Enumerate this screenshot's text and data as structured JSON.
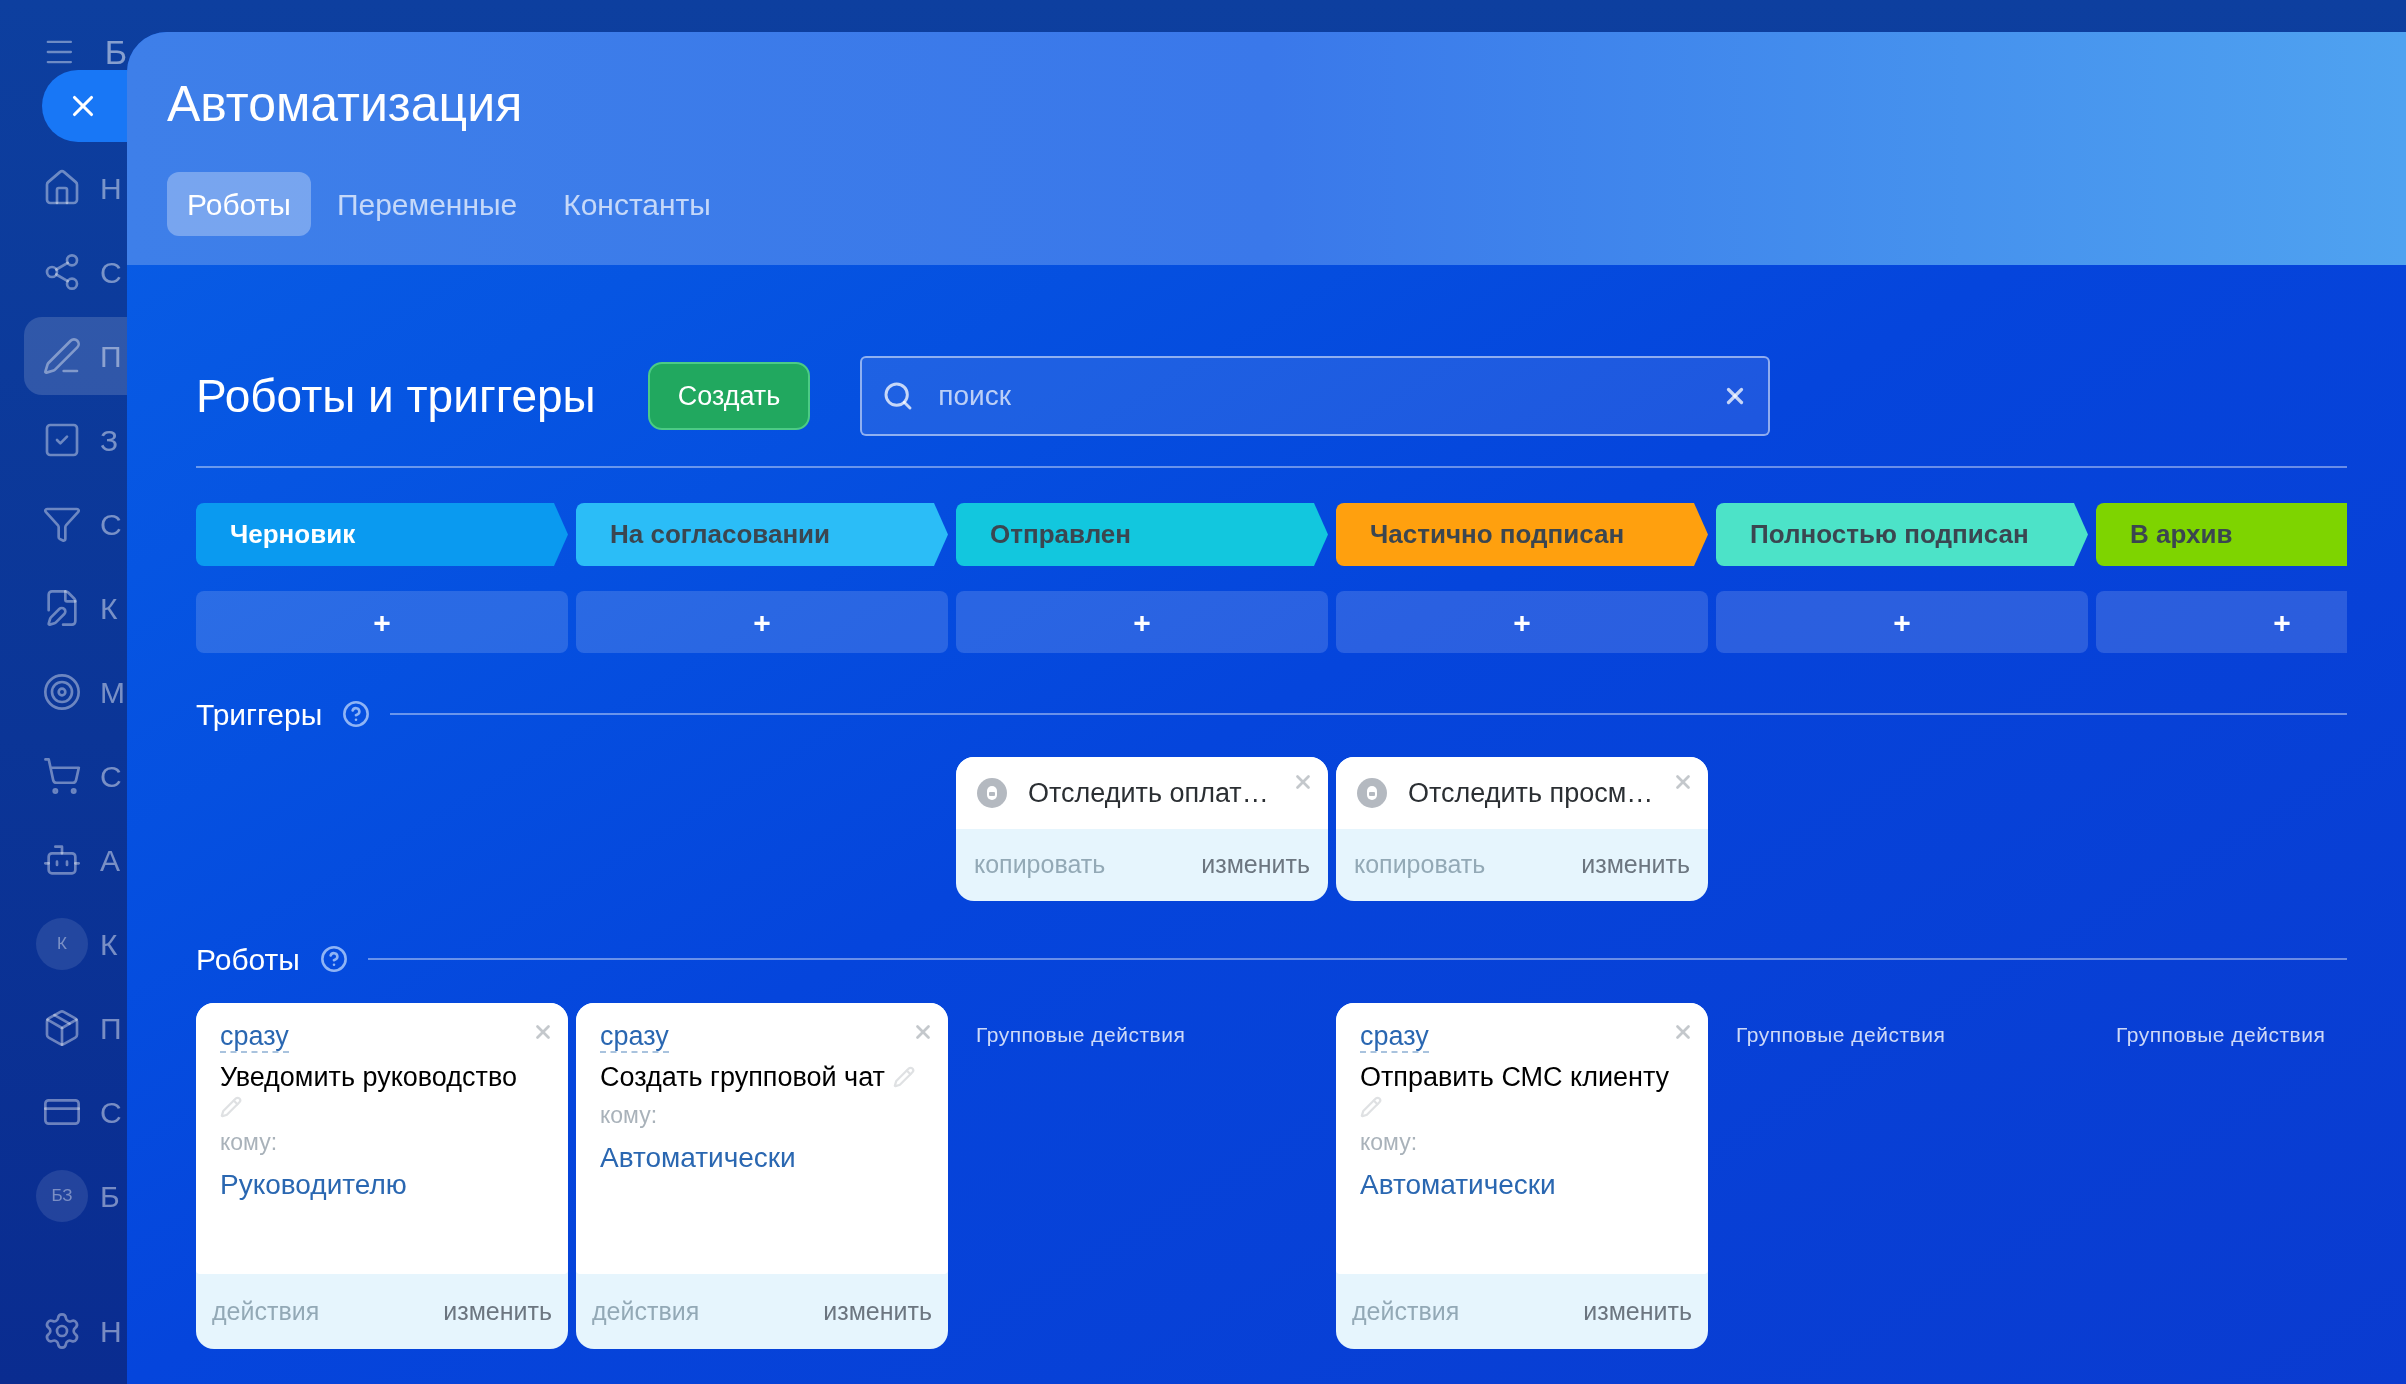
{
  "sidebar": {
    "header_letter": "Б",
    "items": [
      {
        "kind": "icon",
        "letter": "Н",
        "selected": false
      },
      {
        "kind": "icon",
        "letter": "С",
        "selected": false
      },
      {
        "kind": "icon",
        "letter": "П",
        "selected": true
      },
      {
        "kind": "icon",
        "letter": "З",
        "selected": false
      },
      {
        "kind": "icon",
        "letter": "С",
        "selected": false
      },
      {
        "kind": "icon",
        "letter": "К",
        "selected": false
      },
      {
        "kind": "icon",
        "letter": "М",
        "selected": false
      },
      {
        "kind": "icon",
        "letter": "С",
        "selected": false
      },
      {
        "kind": "icon",
        "letter": "А",
        "selected": false
      },
      {
        "kind": "avatar",
        "initials": "К",
        "letter": "К",
        "selected": false
      },
      {
        "kind": "icon",
        "letter": "П",
        "selected": false
      },
      {
        "kind": "icon",
        "letter": "С",
        "selected": false
      },
      {
        "kind": "avatar",
        "initials": "БЗ",
        "letter": "Б",
        "selected": false
      }
    ],
    "footer_letter": "Н"
  },
  "panel": {
    "title": "Автоматизация",
    "tabs": [
      {
        "label": "Роботы",
        "selected": true
      },
      {
        "label": "Переменные",
        "selected": false
      },
      {
        "label": "Константы",
        "selected": false
      }
    ]
  },
  "heading": "Роботы и триггеры",
  "create_button": "Создать",
  "search": {
    "placeholder": "поиск"
  },
  "triggers_label": "Триггеры",
  "robots_label": "Роботы",
  "columns": [
    {
      "stage": {
        "label": "Черновик",
        "color": "#0a9af0"
      },
      "add_button": "+",
      "robots": [
        {
          "timing": "сразу",
          "title": "Уведомить руководство",
          "recipient_label": "кому:",
          "recipient": "Руководителю",
          "actions": "действия",
          "edit": "изменить"
        }
      ]
    },
    {
      "stage": {
        "label": "На согласовании",
        "color": "#2bbdf7"
      },
      "add_button": "+",
      "robots": [
        {
          "timing": "сразу",
          "title": "Создать групповой чат",
          "recipient_label": "кому:",
          "recipient": "Автоматически",
          "actions": "действия",
          "edit": "изменить"
        }
      ]
    },
    {
      "stage": {
        "label": "Отправлен",
        "color": "#12c7de"
      },
      "add_button": "+",
      "triggers": [
        {
          "title": "Отследить оплат…",
          "copy": "копировать",
          "edit": "изменить"
        }
      ],
      "group_actions": "Групповые действия"
    },
    {
      "stage": {
        "label": "Частично подписан",
        "color": "#ffa00e"
      },
      "add_button": "+",
      "triggers": [
        {
          "title": "Отследить просм…",
          "copy": "копировать",
          "edit": "изменить"
        }
      ],
      "robots": [
        {
          "timing": "сразу",
          "title": "Отправить СМС клиенту",
          "recipient_label": "кому:",
          "recipient": "Автоматически",
          "actions": "действия",
          "edit": "изменить"
        }
      ]
    },
    {
      "stage": {
        "label": "Полностью подписан",
        "color": "#4ce3c8"
      },
      "add_button": "+",
      "group_actions": "Групповые действия"
    },
    {
      "stage": {
        "label": "В архив",
        "color": "#7ed400"
      },
      "add_button": "+",
      "group_actions": "Групповые действия"
    }
  ]
}
